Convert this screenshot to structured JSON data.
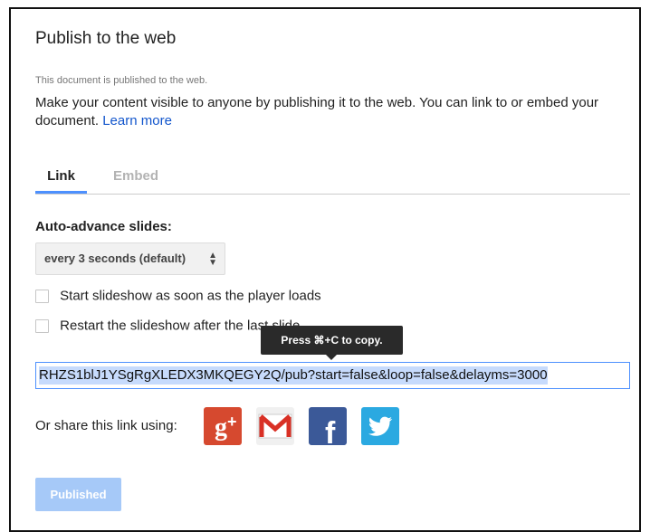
{
  "dialog": {
    "title": "Publish to the web",
    "status_note": "This document is published to the web.",
    "description": "Make your content visible to anyone by publishing it to the web. You can link to or embed your document.",
    "learn_more": "Learn more"
  },
  "tabs": [
    {
      "label": "Link",
      "active": true
    },
    {
      "label": "Embed",
      "active": false
    }
  ],
  "auto_advance": {
    "label": "Auto-advance slides:",
    "selected": "every 3 seconds (default)",
    "arrows": "▲▼"
  },
  "checkboxes": [
    {
      "label": "Start slideshow as soon as the player loads",
      "checked": false
    },
    {
      "label": "Restart the slideshow after the last slide",
      "checked": false
    }
  ],
  "tooltip": "Press ⌘+C to copy.",
  "link_field": {
    "value": "RHZS1blJ1YSgRgXLEDX3MKQEGY2Q/pub?start=false&loop=false&delayms=3000"
  },
  "share": {
    "label": "Or share this link using:",
    "services": [
      {
        "name": "Google+",
        "icon": "google-plus-icon",
        "color": "#d6492f"
      },
      {
        "name": "Gmail",
        "icon": "gmail-icon",
        "color": "#d93025"
      },
      {
        "name": "Facebook",
        "icon": "facebook-icon",
        "color": "#3b5998"
      },
      {
        "name": "Twitter",
        "icon": "twitter-icon",
        "color": "#2ba9e1"
      }
    ]
  },
  "publish_button": {
    "label": "Published",
    "disabled": true
  },
  "colors": {
    "accent": "#4d90fe",
    "link": "#1155cc",
    "button_disabled": "#a6c9f8"
  }
}
